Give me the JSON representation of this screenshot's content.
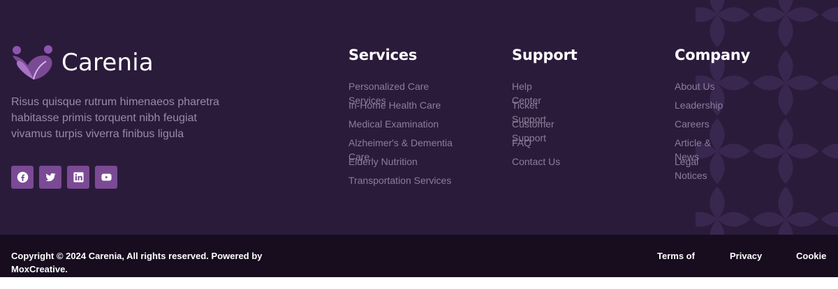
{
  "brand": {
    "name": "Carenia",
    "description": "Risus quisque rutrum himenaeos pharetra habitasse primis torquent nibh feugiat vivamus turpis viverra finibus ligula",
    "logo_icon": "heart-people-logo"
  },
  "socials": [
    {
      "icon": "facebook-icon"
    },
    {
      "icon": "twitter-icon"
    },
    {
      "icon": "linkedin-icon"
    },
    {
      "icon": "youtube-icon"
    }
  ],
  "columns": {
    "services": {
      "title": "Services",
      "links": [
        "Personalized Care Services",
        "In-Home Health Care",
        "Medical Examination",
        "Alzheimer's & Dementia Care",
        "Elderly Nutrition",
        "Transportation Services"
      ]
    },
    "support": {
      "title": "Support",
      "links": [
        "Help Center",
        "Ticket Support",
        "Customer Support",
        "FAQ",
        "Contact Us"
      ]
    },
    "company": {
      "title": "Company",
      "links": [
        "About Us",
        "Leadership",
        "Careers",
        "Article & News",
        "Legal Notices"
      ]
    }
  },
  "bottom": {
    "copyright": "Copyright © 2024 Carenia, All rights reserved. Powered by MoxCreative.",
    "links": [
      "Terms of",
      "Privacy",
      "Cookie"
    ]
  },
  "colors": {
    "footer_bg": "#2b1b3b",
    "bottom_bg": "#170d1f",
    "accent": "#7b4a94",
    "muted_text": "#8c7d99"
  }
}
